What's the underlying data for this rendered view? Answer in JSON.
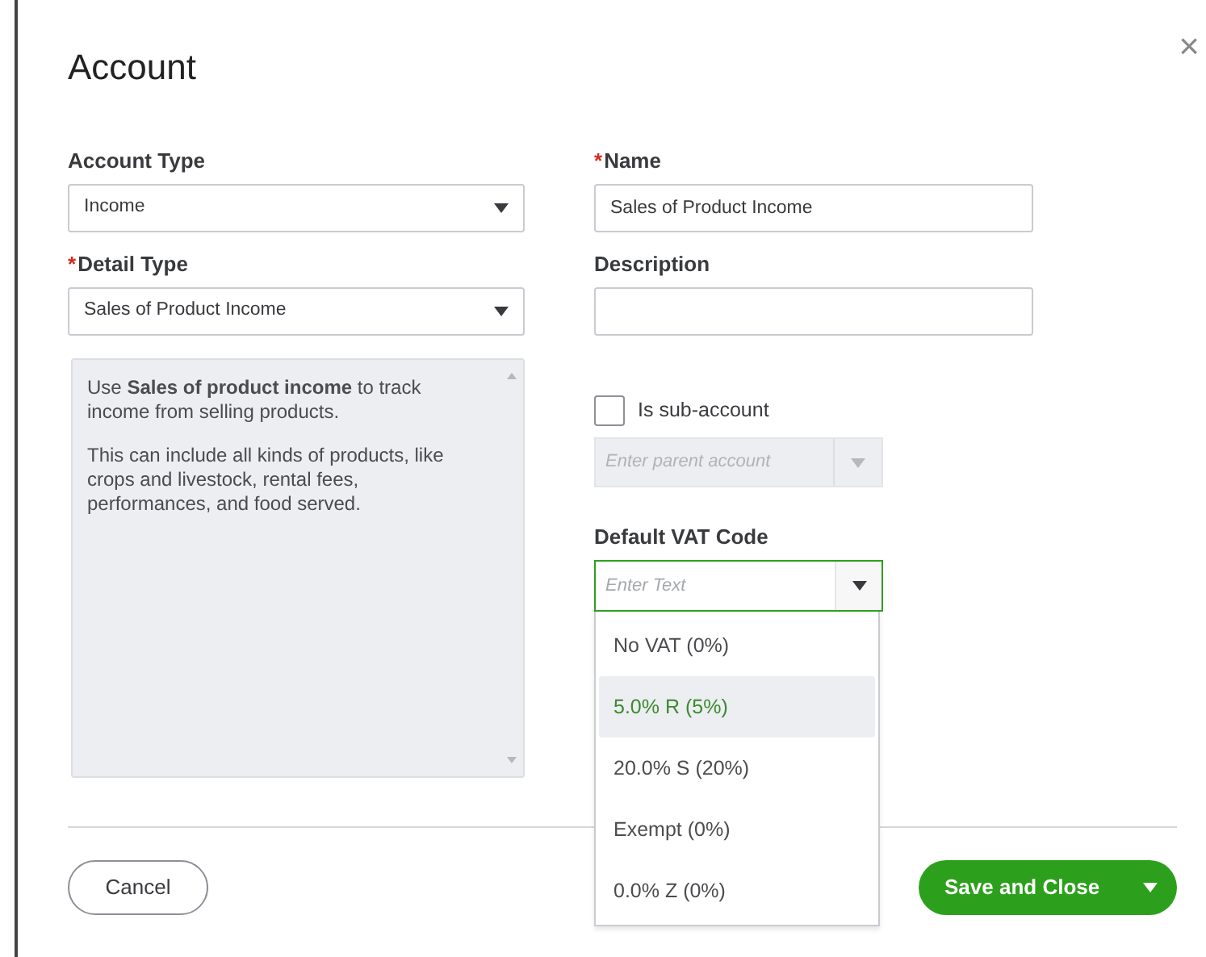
{
  "title": "Account",
  "close": "×",
  "account_type": {
    "label": "Account Type",
    "value": "Income"
  },
  "detail_type": {
    "mark": "*",
    "label": "Detail Type",
    "value": "Sales of Product Income"
  },
  "help_text": [
    "Use **Sales of product income** to track income from selling products.",
    "This can include all kinds of products, like crops and livestock, rental fees, performances, and food served."
  ],
  "name": {
    "mark": "*",
    "label": "Name",
    "value": "Sales of Product Income"
  },
  "description": {
    "label": "Description"
  },
  "sub_account": {
    "label": "Is sub-account",
    "checked": false,
    "placeholder": "Enter parent account",
    "disabled": true
  },
  "vat": {
    "label": "Default VAT Code",
    "placeholder": "Enter Text",
    "expanded": true,
    "options": [
      {
        "label": "No VAT (0%)",
        "selected": false
      },
      {
        "label": "5.0% R (5%)",
        "selected": true
      },
      {
        "label": "20.0% S (20%)",
        "selected": false
      },
      {
        "label": "Exempt (0%)",
        "selected": false
      },
      {
        "label": "0.0% Z (0%)",
        "selected": false
      }
    ]
  },
  "buttons": {
    "cancel": "Cancel",
    "save": "Save and Close"
  }
}
